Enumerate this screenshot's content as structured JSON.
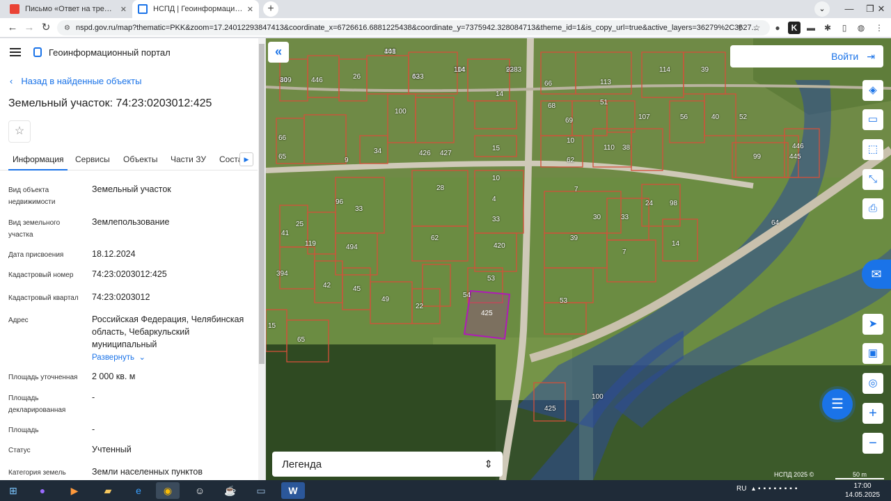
{
  "browser": {
    "tabs": [
      {
        "title": "Письмо «Ответ на требование",
        "favicon": "gmail-icon",
        "active": false
      },
      {
        "title": "НСПД | Геоинформационный п",
        "favicon": "nspd-icon",
        "active": true
      }
    ],
    "url": "nspd.gov.ru/map?thematic=PKK&zoom=17.24012293847413&coordinate_x=6726616.6881225438&coordinate_y=7375942.328084713&theme_id=1&is_copy_url=true&active_layers=36279%2C3627..."
  },
  "panel": {
    "portal_title": "Геоинформационный портал",
    "back_label": "Назад в найденные объекты",
    "object_title": "Земельный участок: 74:23:0203012:425",
    "tabs": [
      "Информация",
      "Сервисы",
      "Объекты",
      "Части ЗУ",
      "Соста"
    ],
    "rows": [
      {
        "label": "Вид объекта недвижимости",
        "value": "Земельный участок"
      },
      {
        "label": "Вид земельного участка",
        "value": "Землепользование"
      },
      {
        "label": "Дата присвоения",
        "value": "18.12.2024"
      },
      {
        "label": "Кадастровый номер",
        "value": "74:23:0203012:425"
      },
      {
        "label": "Кадастровый квартал",
        "value": "74:23:0203012"
      },
      {
        "label": "Адрес",
        "value": "Российская Федерация, Челябинская область, Чебаркульский муниципальный"
      },
      {
        "label": "Площадь уточненная",
        "value": "2 000 кв. м"
      },
      {
        "label": "Площадь декларированная",
        "value": "-"
      },
      {
        "label": "Площадь",
        "value": "-"
      },
      {
        "label": "Статус",
        "value": "Учтенный"
      },
      {
        "label": "Категория земель",
        "value": "Земли населенных пунктов"
      }
    ],
    "expand_label": "Развернуть"
  },
  "map": {
    "login_label": "Войти",
    "legend_label": "Легенда",
    "copyright": "НСПД 2025 ©",
    "scale_label": "50 m",
    "selected_parcel": "425",
    "parcel_numbers": [
      "108",
      "104",
      "93",
      "423",
      "449",
      "446",
      "26",
      "100",
      "14",
      "66",
      "68",
      "113",
      "114",
      "39",
      "51",
      "107",
      "56",
      "40",
      "52",
      "426",
      "427",
      "15",
      "69",
      "10",
      "62",
      "110",
      "38",
      "99",
      "445",
      "446",
      "66",
      "65",
      "34",
      "9",
      "28",
      "10",
      "4",
      "33",
      "7",
      "24",
      "98",
      "96",
      "33",
      "30",
      "33",
      "25",
      "119",
      "494",
      "62",
      "420",
      "39",
      "7",
      "14",
      "64",
      "41",
      "394",
      "42",
      "45",
      "49",
      "22",
      "53",
      "54",
      "53",
      "15",
      "65",
      "100",
      "425",
      "441",
      "114",
      "2283",
      "63",
      "30"
    ],
    "colors": {
      "accent": "#1a73e8",
      "parcel_border": "#d4503a",
      "selected_border": "#b01ab8",
      "water": "#2b4a9a"
    }
  },
  "taskbar": {
    "language": "RU",
    "time": "17:00",
    "date": "14.05.2025"
  }
}
